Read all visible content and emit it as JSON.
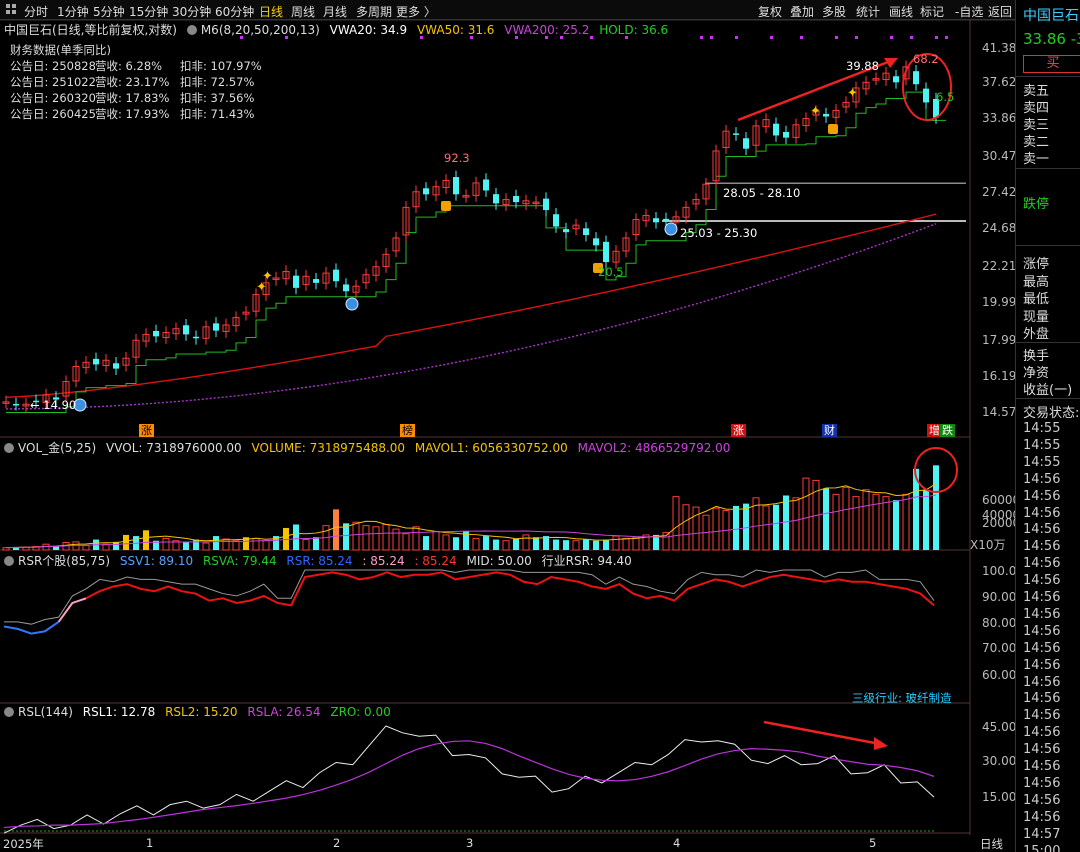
{
  "toolbar": {
    "periods": [
      "分时",
      "1分钟",
      "5分钟",
      "15分钟",
      "30分钟",
      "60分钟",
      "日线",
      "周线",
      "月线",
      "多周期",
      "更多 〉"
    ],
    "active": "日线",
    "right": [
      "复权",
      "叠加",
      "多股",
      "统计",
      "画线",
      "标记",
      "-自选",
      "返回"
    ]
  },
  "main_header": {
    "title": "中国巨石(日线,等比前复权,对数)",
    "ma": "M6(8,20,50,200,13)",
    "vwa20": "VWA20: 34.9",
    "vwa50": "VWA50: 31.6",
    "vwa200": "VWA200: 25.2",
    "hold": "HOLD: 36.6"
  },
  "fin": {
    "title": "财务数据(单季同比)",
    "rows": [
      {
        "d": "公告日: 250828",
        "r": "营收:  6.28%",
        "k": "扣非: 107.97%"
      },
      {
        "d": "公告日: 251022",
        "r": "营收: 23.17%",
        "k": "扣非:  72.57%"
      },
      {
        "d": "公告日: 260320",
        "r": "营收: 17.83%",
        "k": "扣非:  37.56%"
      },
      {
        "d": "公告日: 260425",
        "r": "营收: 17.93%",
        "k": "扣非:  71.43%"
      }
    ]
  },
  "price_axis": [
    "41.38",
    "37.62",
    "33.86",
    "30.47",
    "27.42",
    "24.68",
    "22.21",
    "19.99",
    "17.99",
    "16.19",
    "14.57"
  ],
  "annotations": {
    "p923": "92.3",
    "p205": "20.5",
    "p1490": "14.90",
    "p3988": "39.88",
    "p682": "68.2",
    "p65": "6.5",
    "r1": "28.05 - 28.10",
    "r2": "25.03 - 25.30"
  },
  "event_tags": [
    "涨",
    "榜",
    "涨",
    "财",
    "增",
    "跌"
  ],
  "vol_header": {
    "name": "VOL_金(5,25)",
    "vvol": "VVOL: 7318976000.00",
    "volume": "VOLUME: 7318975488.00",
    "mavol1": "MAVOL1: 6056330752.00",
    "mavol2": "MAVOL2: 4866529792.00"
  },
  "vol_axis": [
    "60000",
    "40000",
    "20000"
  ],
  "vol_unit": "X10万",
  "rsr_header": {
    "name": "RSR个股(85,75)",
    "ssv1": "SSV1: 89.10",
    "rsva": "RSVA: 79.44",
    "rsr": "RSR: 85.24",
    "v2": ": 85.24",
    "v3": ": 85.24",
    "mid": "MID: 50.00",
    "ind": "行业RSR: 94.40"
  },
  "rsr_axis": [
    "100.0",
    "90.00",
    "80.00",
    "70.00",
    "60.00"
  ],
  "industry": "三级行业: 玻纤制造",
  "rsl_header": {
    "name": "RSL(144)",
    "rsl1": "RSL1: 12.78",
    "rsl2": "RSL2: 15.20",
    "rsla": "RSLA: 26.54",
    "zro": "ZRO: 0.00"
  },
  "rsl_axis": [
    "45.00",
    "30.00",
    "15.00"
  ],
  "x_axis": {
    "year": "2025年",
    "months": [
      "1",
      "2",
      "3",
      "4",
      "5"
    ],
    "period": "日线"
  },
  "side": {
    "name": "中国巨石",
    "price": "33.86",
    "chg": "-3",
    "buy": "买",
    "asks": [
      "卖五",
      "卖四",
      "卖三",
      "卖二",
      "卖一"
    ],
    "status": "跌停",
    "stats": [
      "涨停",
      "最高",
      "最低",
      "现量",
      "外盘"
    ],
    "stats2": [
      "换手",
      "净资",
      "收益(一)"
    ],
    "trade": "交易状态:",
    "times": [
      "14:55",
      "14:55",
      "14:55",
      "14:56",
      "14:56",
      "14:56",
      "14:56",
      "14:56",
      "14:56",
      "14:56",
      "14:56",
      "14:56",
      "14:56",
      "14:56",
      "14:56",
      "14:56",
      "14:56",
      "14:56",
      "14:56",
      "14:56",
      "14:56",
      "14:56",
      "14:56",
      "14:56",
      "14:57",
      "15:00"
    ]
  },
  "colors": {
    "up": "#ff3b3b",
    "down": "#4ff3f3",
    "ma_green": "#22bb22",
    "ma_red": "#dd1111",
    "ma_purple": "#aa33cc",
    "yellow": "#f5c400",
    "bg": "#000000"
  },
  "chart_data": [
    {
      "type": "candlestick",
      "title": "中国巨石(日线,等比前复权,对数)",
      "ylim": [
        14.57,
        41.38
      ],
      "y_scale": "log",
      "candles_close_approx": [
        15.0,
        14.9,
        14.9,
        15.0,
        15.3,
        15.1,
        15.9,
        16.6,
        16.8,
        16.7,
        16.9,
        16.5,
        17.0,
        17.9,
        18.2,
        18.1,
        18.3,
        18.5,
        18.2,
        18.0,
        18.6,
        18.4,
        18.7,
        19.1,
        19.4,
        20.4,
        21.1,
        21.4,
        21.8,
        20.8,
        21.5,
        21.1,
        21.7,
        21.2,
        20.6,
        20.9,
        21.6,
        22.1,
        22.9,
        24.0,
        26.2,
        27.4,
        27.2,
        27.8,
        28.3,
        27.2,
        27.1,
        28.1,
        27.5,
        26.5,
        26.8,
        26.6,
        26.7,
        26.6,
        26.0,
        24.8,
        24.4,
        24.9,
        24.2,
        23.5,
        22.4,
        23.1,
        24.0,
        25.3,
        25.6,
        25.1,
        25.2,
        25.5,
        26.2,
        26.8,
        28.0,
        30.8,
        32.6,
        32.3,
        31.0,
        33.1,
        33.7,
        32.2,
        32.0,
        33.2,
        33.8,
        34.5,
        34.0,
        34.6,
        35.4,
        36.9,
        37.5,
        37.9,
        38.5,
        37.5,
        39.2,
        37.3,
        35.4,
        33.9
      ],
      "annotations": [
        "92.3",
        "20.5",
        "14.90",
        "39.88",
        "68.2",
        "6.5",
        "28.05 - 28.10",
        "25.03 - 25.30"
      ]
    },
    {
      "type": "bar",
      "title": "VOL_金(5,25)",
      "unit": "X10万",
      "ylim": [
        0,
        70000
      ],
      "values_approx": [
        2000,
        2500,
        2500,
        3000,
        5000,
        3500,
        6500,
        7000,
        4000,
        9000,
        5000,
        7000,
        13000,
        12000,
        17000,
        8000,
        10000,
        8000,
        7000,
        9000,
        6000,
        12000,
        9500,
        8000,
        11000,
        10000,
        8000,
        12000,
        19000,
        22000,
        9000,
        11000,
        21000,
        35000,
        23000,
        24000,
        21000,
        20000,
        22000,
        18000,
        14000,
        20000,
        12000,
        16000,
        13000,
        11000,
        16000,
        10000,
        12000,
        9000,
        8000,
        9500,
        13000,
        11000,
        12000,
        9000,
        8500,
        8000,
        9000,
        8000,
        9000,
        12000,
        10000,
        11000,
        13000,
        13000,
        15000,
        46000,
        39000,
        37000,
        30000,
        36000,
        34000,
        38000,
        40000,
        45000,
        38000,
        39000,
        47000,
        45000,
        62000,
        60000,
        53000,
        48000,
        54000,
        46000,
        52000,
        48000,
        46000,
        43000,
        48000,
        70000,
        52000,
        73000
      ]
    },
    {
      "type": "line",
      "title": "RSR个股(85,75)",
      "ylim": [
        50,
        100
      ],
      "series": [
        {
          "name": "RSR",
          "values_approx": [
            76,
            75,
            73,
            74,
            78,
            86,
            88,
            91,
            93,
            94,
            92,
            91,
            93,
            91,
            90,
            87,
            88,
            86,
            87,
            89,
            86,
            85,
            97,
            98,
            99,
            98,
            96,
            97,
            99,
            97,
            98,
            98,
            99,
            96,
            97,
            98,
            99,
            98,
            95,
            94,
            97,
            96,
            95,
            93,
            92,
            94,
            90,
            88,
            89,
            87,
            92,
            94,
            96,
            95,
            93,
            95,
            97,
            98,
            97,
            96,
            95,
            96,
            95,
            95,
            94,
            93,
            92,
            90,
            85
          ]
        }
      ]
    },
    {
      "type": "line",
      "title": "RSL(144)",
      "ylim": [
        0,
        50
      ],
      "series": [
        {
          "name": "RSL1",
          "values_approx": [
            2,
            3,
            3,
            4,
            3,
            5,
            6,
            8,
            9,
            10,
            12,
            11,
            13,
            12,
            14,
            16,
            18,
            20,
            22,
            26,
            28,
            32,
            38,
            44,
            46,
            42,
            40,
            36,
            34,
            30,
            28,
            24,
            22,
            20,
            19,
            22,
            24,
            26,
            28,
            32,
            34,
            38,
            42,
            40,
            36,
            34,
            30,
            31,
            32,
            30,
            31,
            28,
            26,
            27,
            24,
            22,
            12.78
          ]
        }
      ]
    }
  ]
}
